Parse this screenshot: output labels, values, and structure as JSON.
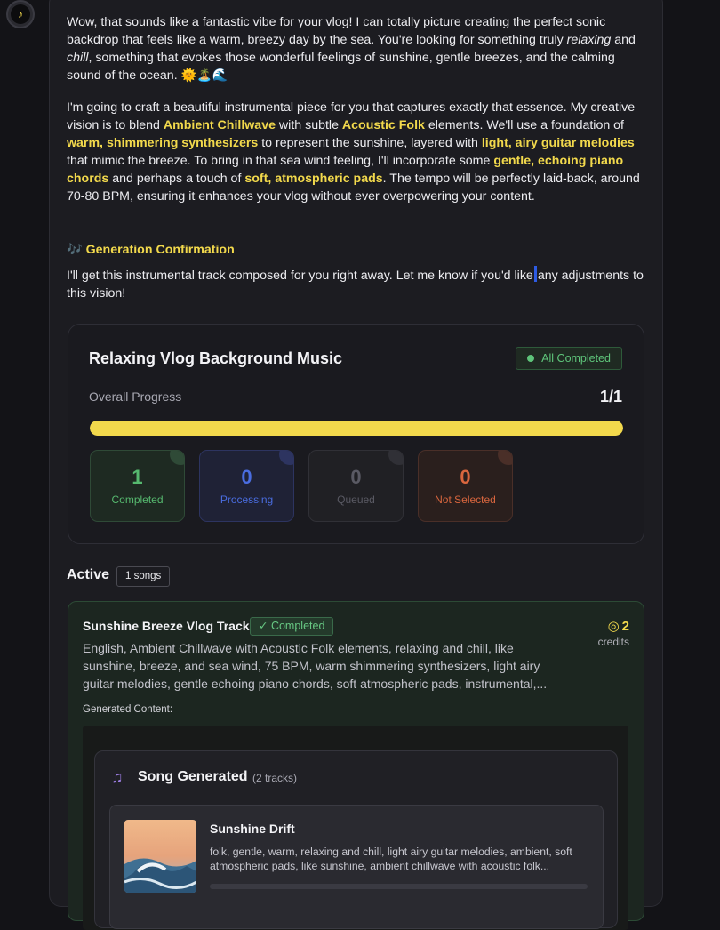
{
  "assistant": {
    "avatar_icon": "music-note-icon"
  },
  "message": {
    "p1_a": "Wow, that sounds like a fantastic vibe for your vlog! I can totally picture creating the perfect sonic backdrop that feels like a warm, breezy day by the sea. You're looking for something truly ",
    "p1_relaxing": "relaxing",
    "p1_b": " and ",
    "p1_chill": "chill",
    "p1_c": ", something that evokes those wonderful feelings of sunshine, gentle breezes, and the calming sound of the ocean. 🌞🏝️🌊",
    "p2_a": "I'm going to craft a beautiful instrumental piece for you that captures exactly that essence. My creative vision is to blend ",
    "p2_h1": "Ambient Chillwave",
    "p2_b": " with subtle ",
    "p2_h2": "Acoustic Folk",
    "p2_c": " elements. We'll use a foundation of ",
    "p2_h3": "warm, shimmering synthesizers",
    "p2_d": " to represent the sunshine, layered with ",
    "p2_h4": "light, airy guitar melodies",
    "p2_e": " that mimic the breeze. To bring in that sea wind feeling, I'll incorporate some ",
    "p2_h5": "gentle, echoing piano chords",
    "p2_f": " and perhaps a touch of ",
    "p2_h6": "soft, atmospheric pads",
    "p2_g": ". The tempo will be perfectly laid-back, around 70-80 BPM, ensuring it enhances your vlog without ever overpowering your content.",
    "confirm_icon": "🎶",
    "confirm_title": "Generation Confirmation",
    "p3_a": "I'll get this instrumental track composed for you right away. Let me know if you'd like",
    "p3_b": "any adjustments to this vision!"
  },
  "progress": {
    "title": "Relaxing Vlog Background Music",
    "status_badge": "All Completed",
    "overall_label": "Overall Progress",
    "overall_count": "1/1",
    "fraction": 1.0,
    "stats": [
      {
        "value": "1",
        "label": "Completed"
      },
      {
        "value": "0",
        "label": "Processing"
      },
      {
        "value": "0",
        "label": "Queued"
      },
      {
        "value": "0",
        "label": "Not Selected"
      }
    ]
  },
  "active": {
    "label": "Active",
    "count_badge": "1 songs"
  },
  "song": {
    "title": "Sunshine Breeze Vlog Track",
    "status": "✓ Completed",
    "credits_value": "2",
    "credits_label": "credits",
    "credits_icon": "coins-icon",
    "description": "English, Ambient Chillwave with Acoustic Folk elements, relaxing and chill, like sunshine, breeze, and sea wind, 75 BPM, warm shimmering synthesizers, light airy guitar melodies, gentle echoing piano chords, soft atmospheric pads, instrumental,...",
    "generated_label": "Generated Content:",
    "generated": {
      "title": "Song Generated",
      "tracks_count": "(2 tracks)",
      "track": {
        "title": "Sunshine Drift",
        "tags": "folk, gentle, warm, relaxing and chill, light airy guitar melodies, ambient, soft atmospheric pads, like sunshine, ambient chillwave with acoustic folk..."
      }
    }
  },
  "colors": {
    "accent_yellow": "#f2d94c",
    "completed_green": "#56b96f",
    "processing_blue": "#4a6de0",
    "queued_gray": "#5a5a64",
    "not_selected_orange": "#d9663e"
  }
}
